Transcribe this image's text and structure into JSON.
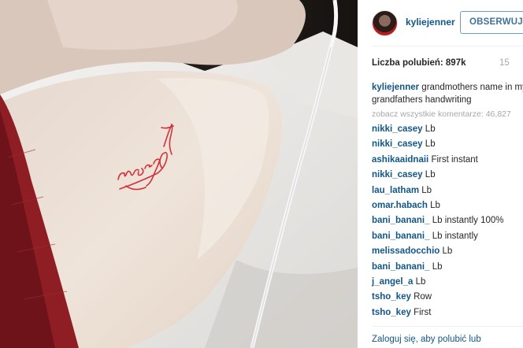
{
  "post": {
    "username": "kyliejenner",
    "follow_label": "OBSERWUJ",
    "likes_label": "Liczba polubień: 897k",
    "time": "15",
    "caption": {
      "username": "kyliejenner",
      "line1": "grandmothers name in my",
      "line2": "grandfathers handwriting"
    },
    "all_comments_label": "zobacz wszystkie komentarze: 46,827",
    "comments": [
      {
        "user": "nikki_casey",
        "text": "Lb"
      },
      {
        "user": "nikki_casey",
        "text": "Lb"
      },
      {
        "user": "ashikaaidnaii",
        "text": "First instant"
      },
      {
        "user": "nikki_casey",
        "text": "Lb"
      },
      {
        "user": "lau_latham",
        "text": "Lb"
      },
      {
        "user": "omar.habach",
        "text": "Lb"
      },
      {
        "user": "bani_banani_",
        "text": "Lb instantly 100%"
      },
      {
        "user": "bani_banani_",
        "text": "Lb instantly"
      },
      {
        "user": "melissadocchio",
        "text": "Lb"
      },
      {
        "user": "bani_banani_",
        "text": "Lb"
      },
      {
        "user": "j_angel_a",
        "text": "Lb"
      },
      {
        "user": "tsho_key",
        "text": "Row"
      },
      {
        "user": "tsho_key",
        "text": "First"
      }
    ],
    "login_prompt": "Zaloguj się, aby polubić lub"
  },
  "colors": {
    "username_link": "#125688",
    "follow_border": "#6a9ec9",
    "muted": "#a5a7aa",
    "tattoo_red": "#d4303a"
  },
  "icons": {
    "avatar": "profile-photo"
  }
}
